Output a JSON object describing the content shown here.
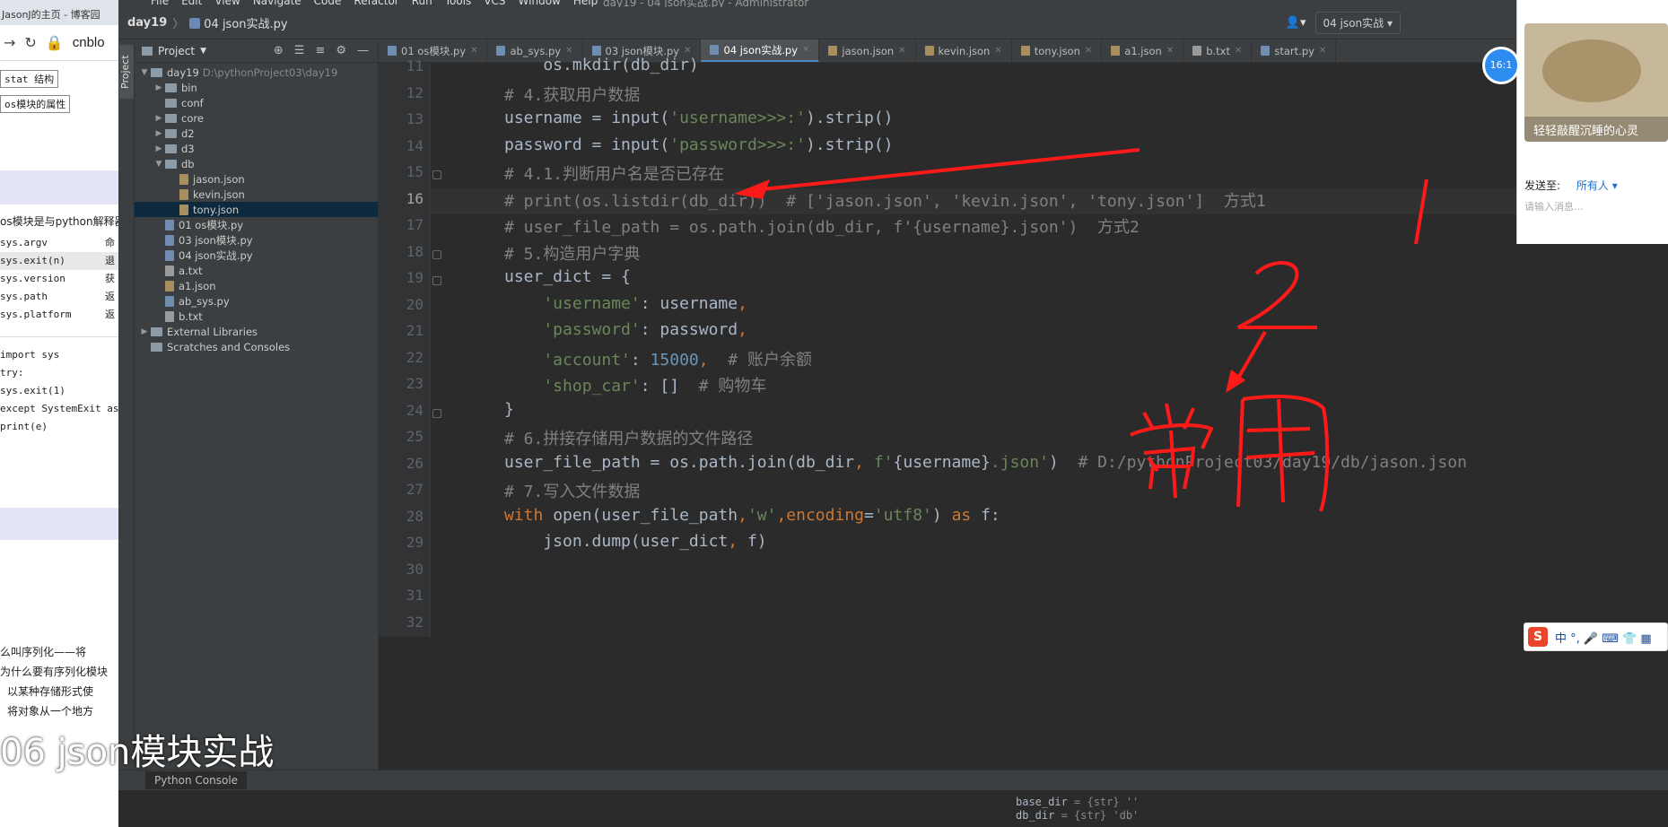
{
  "browser": {
    "tab_title": "JasonJ的主页 - 博客园",
    "url": "cnblo",
    "chip1": "stat 结构",
    "chip2": "os模块的属性",
    "intro_text": "os模块是与python解释器",
    "table": [
      {
        "name": "sys.argv",
        "desc": "命"
      },
      {
        "name": "sys.exit(n)",
        "desc": "退"
      },
      {
        "name": "sys.version",
        "desc": "获"
      },
      {
        "name": "sys.path",
        "desc": "返"
      },
      {
        "name": "sys.platform",
        "desc": "返"
      }
    ],
    "code": [
      "import sys",
      "try:",
      "    sys.exit(1)",
      "except SystemExit as",
      "    print(e)"
    ],
    "bottom": [
      "么叫序列化——将",
      "为什么要有序列化模块",
      "以某种存储形式使",
      "将对象从一个地方"
    ]
  },
  "ide": {
    "menu": [
      "File",
      "Edit",
      "View",
      "Navigate",
      "Code",
      "Refactor",
      "Run",
      "Tools",
      "VCS",
      "Window",
      "Help"
    ],
    "window_title": "day19 - 04 json实战.py - Administrator",
    "breadcrumb_project": "day19",
    "breadcrumb_file": "04 json实战.py",
    "run_config": "04 json实战",
    "project_label": "Project",
    "tool_strip_label": "Project",
    "tree": [
      {
        "label": "day19",
        "path": "D:\\pythonProject03\\day19",
        "depth": 0,
        "type": "folder",
        "open": true
      },
      {
        "label": "bin",
        "depth": 1,
        "type": "folder"
      },
      {
        "label": "conf",
        "depth": 1,
        "type": "folder",
        "leaf": true
      },
      {
        "label": "core",
        "depth": 1,
        "type": "folder"
      },
      {
        "label": "d2",
        "depth": 1,
        "type": "folder"
      },
      {
        "label": "d3",
        "depth": 1,
        "type": "folder"
      },
      {
        "label": "db",
        "depth": 1,
        "type": "folder",
        "open": true
      },
      {
        "label": "jason.json",
        "depth": 2,
        "type": "json"
      },
      {
        "label": "kevin.json",
        "depth": 2,
        "type": "json"
      },
      {
        "label": "tony.json",
        "depth": 2,
        "type": "json",
        "selected": true
      },
      {
        "label": "01 os模块.py",
        "depth": 1,
        "type": "py"
      },
      {
        "label": "03 json模块.py",
        "depth": 1,
        "type": "py"
      },
      {
        "label": "04 json实战.py",
        "depth": 1,
        "type": "py"
      },
      {
        "label": "a.txt",
        "depth": 1,
        "type": "txt"
      },
      {
        "label": "a1.json",
        "depth": 1,
        "type": "json"
      },
      {
        "label": "ab_sys.py",
        "depth": 1,
        "type": "py"
      },
      {
        "label": "b.txt",
        "depth": 1,
        "type": "txt"
      },
      {
        "label": "External Libraries",
        "depth": 0,
        "type": "lib"
      },
      {
        "label": "Scratches and Consoles",
        "depth": 0,
        "type": "scratch"
      }
    ],
    "tabs": [
      {
        "label": "01 os模块.py",
        "kind": "py"
      },
      {
        "label": "ab_sys.py",
        "kind": "py"
      },
      {
        "label": "03 json模块.py",
        "kind": "py"
      },
      {
        "label": "04 json实战.py",
        "kind": "py",
        "active": true
      },
      {
        "label": "jason.json",
        "kind": "json"
      },
      {
        "label": "kevin.json",
        "kind": "json"
      },
      {
        "label": "tony.json",
        "kind": "json"
      },
      {
        "label": "a1.json",
        "kind": "json"
      },
      {
        "label": "b.txt",
        "kind": "txt"
      },
      {
        "label": "start.py",
        "kind": "py"
      }
    ],
    "current_line": 16,
    "lines": [
      {
        "n": 11,
        "tokens": [
          [
            "fn",
            "    os.mkdir(db_dir)"
          ]
        ]
      },
      {
        "n": 12,
        "tokens": [
          [
            "cm",
            "# 4.获取用户数据"
          ]
        ]
      },
      {
        "n": 13,
        "tokens": [
          [
            "fn",
            "username = "
          ],
          [
            "fn",
            "input("
          ],
          [
            "st",
            "'username>>>:'"
          ],
          [
            "fn",
            ").strip()"
          ]
        ]
      },
      {
        "n": 14,
        "tokens": [
          [
            "fn",
            "password = "
          ],
          [
            "fn",
            "input("
          ],
          [
            "st",
            "'password>>>:'"
          ],
          [
            "fn",
            ").strip()"
          ]
        ]
      },
      {
        "n": 15,
        "tokens": [
          [
            "cm",
            "# 4.1.判断用户名是否已存在"
          ]
        ]
      },
      {
        "n": 16,
        "tokens": [
          [
            "cm",
            "# print(os.listdir(db_dir))  # ['jason.json', 'kevin.json', 'tony.json']  方式1"
          ]
        ]
      },
      {
        "n": 17,
        "tokens": [
          [
            "cm",
            "# user_file_path = os.path.join(db_dir, f'{username}.json')  方式2"
          ]
        ]
      },
      {
        "n": 18,
        "tokens": [
          [
            "cm",
            "# 5.构造用户字典"
          ]
        ]
      },
      {
        "n": 19,
        "tokens": [
          [
            "fn",
            "user_dict = {"
          ]
        ]
      },
      {
        "n": 20,
        "tokens": [
          [
            "st",
            "    'username'"
          ],
          [
            "fn",
            ": username"
          ],
          [
            "kw",
            ","
          ]
        ]
      },
      {
        "n": 21,
        "tokens": [
          [
            "st",
            "    'password'"
          ],
          [
            "fn",
            ": password"
          ],
          [
            "kw",
            ","
          ]
        ]
      },
      {
        "n": 22,
        "tokens": [
          [
            "st",
            "    'account'"
          ],
          [
            "fn",
            ": "
          ],
          [
            "nm",
            "15000"
          ],
          [
            "kw",
            ","
          ],
          [
            "cm",
            "  # 账户余额"
          ]
        ]
      },
      {
        "n": 23,
        "tokens": [
          [
            "st",
            "    'shop_car'"
          ],
          [
            "fn",
            ": []  "
          ],
          [
            "cm",
            "# 购物车"
          ]
        ]
      },
      {
        "n": 24,
        "tokens": [
          [
            "fn",
            "}"
          ]
        ]
      },
      {
        "n": 25,
        "tokens": [
          [
            "cm",
            "# 6.拼接存储用户数据的文件路径"
          ]
        ]
      },
      {
        "n": 26,
        "tokens": [
          [
            "fn",
            "user_file_path = os.path.join(db_dir"
          ],
          [
            "kw",
            ", "
          ],
          [
            "st",
            "f'"
          ],
          [
            "fn",
            "{username}"
          ],
          [
            "st",
            ".json'"
          ],
          [
            "fn",
            ")  "
          ],
          [
            "cm",
            "# D:/pythonProject03/day19/db/jason.json"
          ]
        ]
      },
      {
        "n": 27,
        "tokens": [
          [
            "cm",
            "# 7.写入文件数据"
          ]
        ]
      },
      {
        "n": 28,
        "tokens": [
          [
            "kw",
            "with "
          ],
          [
            "fn",
            "open(user_file_path"
          ],
          [
            "kw",
            ","
          ],
          [
            "st",
            "'w'"
          ],
          [
            "kw",
            ","
          ],
          [
            "kw",
            "encoding"
          ],
          [
            "fn",
            "="
          ],
          [
            "st",
            "'utf8'"
          ],
          [
            "fn",
            ") "
          ],
          [
            "kw",
            "as "
          ],
          [
            "fn",
            "f:"
          ]
        ]
      },
      {
        "n": 29,
        "tokens": [
          [
            "fn",
            "    json.dump(user_dict"
          ],
          [
            "kw",
            ", "
          ],
          [
            "fn",
            "f)"
          ]
        ]
      },
      {
        "n": 30,
        "tokens": []
      },
      {
        "n": 31,
        "tokens": []
      },
      {
        "n": 32,
        "tokens": []
      }
    ],
    "console_tab": "Python Console",
    "console_vars": [
      {
        "name": "base_dir",
        "value": "= {str} ''"
      },
      {
        "name": "db_dir",
        "value": "= {str} 'db'"
      }
    ]
  },
  "chat": {
    "image_caption": "轻轻敲醒沉睡的心灵",
    "send_to_label": "发送至:",
    "send_to_value": "所有人 ▾",
    "placeholder": "请输入消息..."
  },
  "clock": "16:1",
  "ime": {
    "logo": "S",
    "text": "中 °, 🎤 ⌨ 👕 ▦"
  },
  "caption": "06 json模块实战",
  "annotations": {
    "mark1": "1",
    "mark2": "2",
    "handwritten": "常用"
  },
  "colors": {
    "annotation": "#ff1a1a",
    "editor_bg": "#2b2b2b",
    "comment": "#808080",
    "string": "#6a8759",
    "keyword": "#cc7832",
    "number": "#6897bb"
  }
}
